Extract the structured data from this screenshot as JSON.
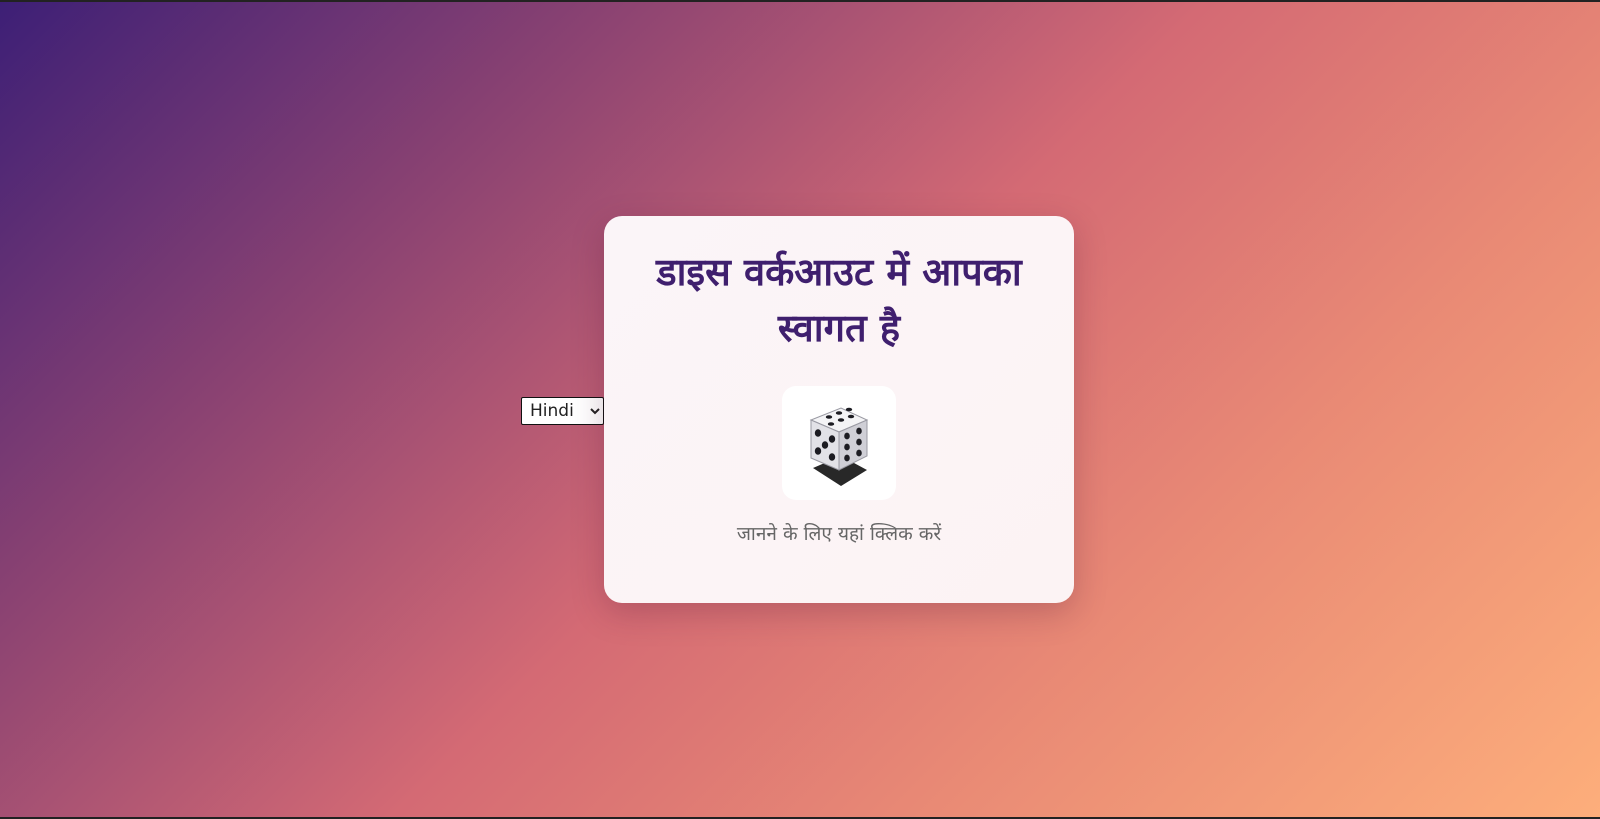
{
  "language_select": {
    "selected": "Hindi"
  },
  "card": {
    "title": "डाइस वर्कआउट में आपका स्वागत है",
    "dice_icon": "die-face-five-icon",
    "hint": "जानने के लिए यहां क्लिक करें"
  },
  "colors": {
    "title": "#3f1f6e",
    "gradient_start": "#3d1f76",
    "gradient_mid": "#d46a74",
    "gradient_end": "#fdae7b"
  }
}
